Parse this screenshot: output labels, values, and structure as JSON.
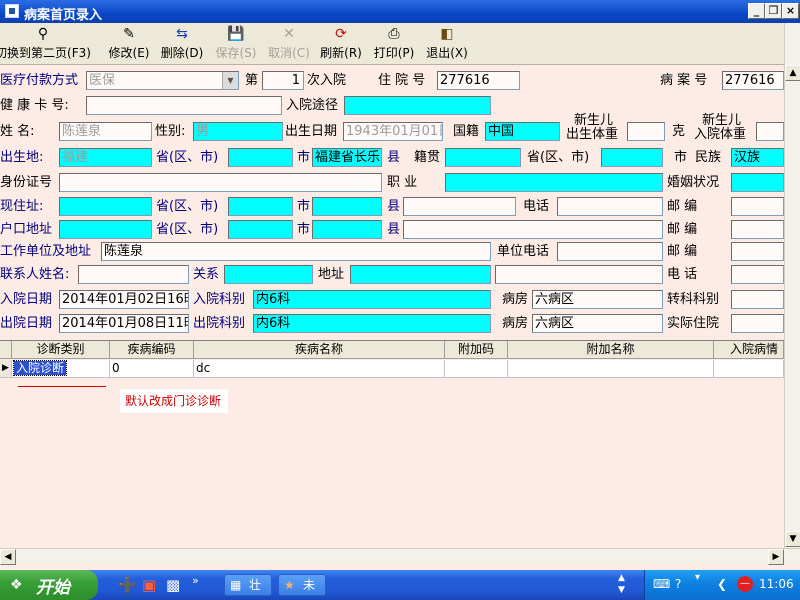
{
  "window": {
    "title": "病案首页录入"
  },
  "toolbar": {
    "switch_page": "切换到第二页(F3)",
    "edit": "修改(E)",
    "delete": "删除(D)",
    "save": "保存(S)",
    "cancel": "取消(C)",
    "refresh": "刷新(R)",
    "print": "打印(P)",
    "exit": "退出(X)"
  },
  "form": {
    "payment_label": "医疗付款方式",
    "payment_value": "医保",
    "admission_no_prefix": "第",
    "admission_no_value": "1",
    "admission_no_suffix": "次入院",
    "inpatient_no_label": "住 院 号",
    "inpatient_no_value": "277616",
    "record_no_label": "病 案 号",
    "record_no_value": "277616",
    "health_card_label": "健 康 卡 号:",
    "health_card_value": "",
    "admission_route_label": "入院途径",
    "admission_route_value": "",
    "name_label": "姓  名:",
    "name_value": "陈莲泉",
    "sex_label": "性别:",
    "sex_value": "男",
    "birth_label": "出生日期",
    "birth_value": "1943年01月01日",
    "nationality_label": "国籍",
    "nationality_value": "中国",
    "newborn_birth_weight_label_1": "新生儿",
    "newborn_birth_weight_label_2": "出生体重",
    "weight_unit": "克",
    "newborn_adm_weight_label_1": "新生儿",
    "newborn_adm_weight_label_2": "入院体重",
    "birthplace_label": "出生地:",
    "birthplace_value": "福建",
    "province_label": "省(区、市)",
    "city_label": "市",
    "birth_city_value": "福建省长乐",
    "county_label": "县",
    "native_label": "籍贯",
    "ethnic_city_label": "市",
    "ethnic_label": "民族",
    "ethnic_value": "汉族",
    "id_label": "身份证号",
    "occupation_label": "职  业",
    "marital_label": "婚姻状况",
    "address_label": "现住址:",
    "phone_label": "电话",
    "postal_label": "邮  编",
    "household_label": "户口地址",
    "work_label": "工作单位及地址",
    "work_value": "陈莲泉",
    "work_phone_label": "单位电话",
    "contact_label": "联系人姓名:",
    "relation_label": "关系",
    "contact_address_label": "地址",
    "tel_label": "电  话",
    "adm_date_label": "入院日期",
    "adm_date_value": "2014年01月02日16时",
    "adm_dept_label": "入院科别",
    "adm_dept_value": "内6科",
    "ward_label": "病房",
    "adm_ward_value": "六病区",
    "transfer_label": "转科科别",
    "dis_date_label": "出院日期",
    "dis_date_value": "2014年01月08日11时",
    "dis_dept_label": "出院科别",
    "dis_dept_value": "内6科",
    "dis_ward_value": "六病区",
    "actual_days_label": "实际住院"
  },
  "grid": {
    "columns": [
      "诊断类别",
      "疾病编码",
      "疾病名称",
      "附加码",
      "附加名称",
      "入院病情"
    ],
    "rows": [
      {
        "type": "入院诊断",
        "code": "0",
        "name": "dc",
        "extra_code": "",
        "extra_name": "",
        "condition": ""
      }
    ],
    "note": "默认改成门诊诊断"
  },
  "taskbar": {
    "start_label": "开始",
    "task1": "壮",
    "task2": "未",
    "clock": "11:06"
  },
  "colors": {
    "form_bg": "#fdece6",
    "field_cyan": "#00ffff",
    "title_blue": "#0a47c8",
    "note_red": "#cc0000"
  }
}
